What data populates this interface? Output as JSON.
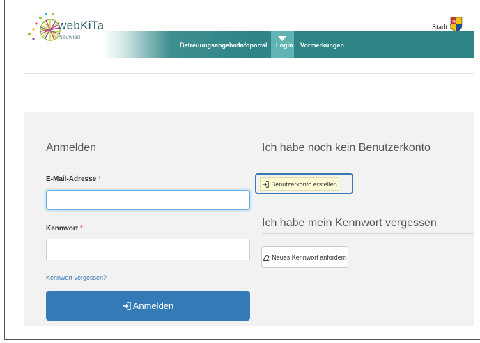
{
  "brand": {
    "name": "webKiTa",
    "subtitle": "Neuwied",
    "city_label": "Stadt Ne"
  },
  "nav": {
    "items": [
      "Betreuungsangebot",
      "Infoportal",
      "Login",
      "Vormerkungen"
    ],
    "active": "Login",
    "color": "#2f8486"
  },
  "login": {
    "heading": "Anmelden",
    "email_label": "E-Mail-Adresse",
    "email_value": "",
    "password_label": "Kennwort",
    "password_value": "",
    "required_mark": "*",
    "forgot_link": "Kennwort vergessen?",
    "submit_label": "Anmelden"
  },
  "register": {
    "heading": "Ich habe noch kein Benutzerkonto",
    "button_label": "Benutzerkonto erstellen"
  },
  "reset": {
    "heading": "Ich habe mein Kennwort vergessen",
    "button_label": "Neues Kennwort anfordern"
  },
  "colors": {
    "primary": "#337ab7",
    "panel": "#f2f2f2",
    "required": "#d9534f"
  }
}
